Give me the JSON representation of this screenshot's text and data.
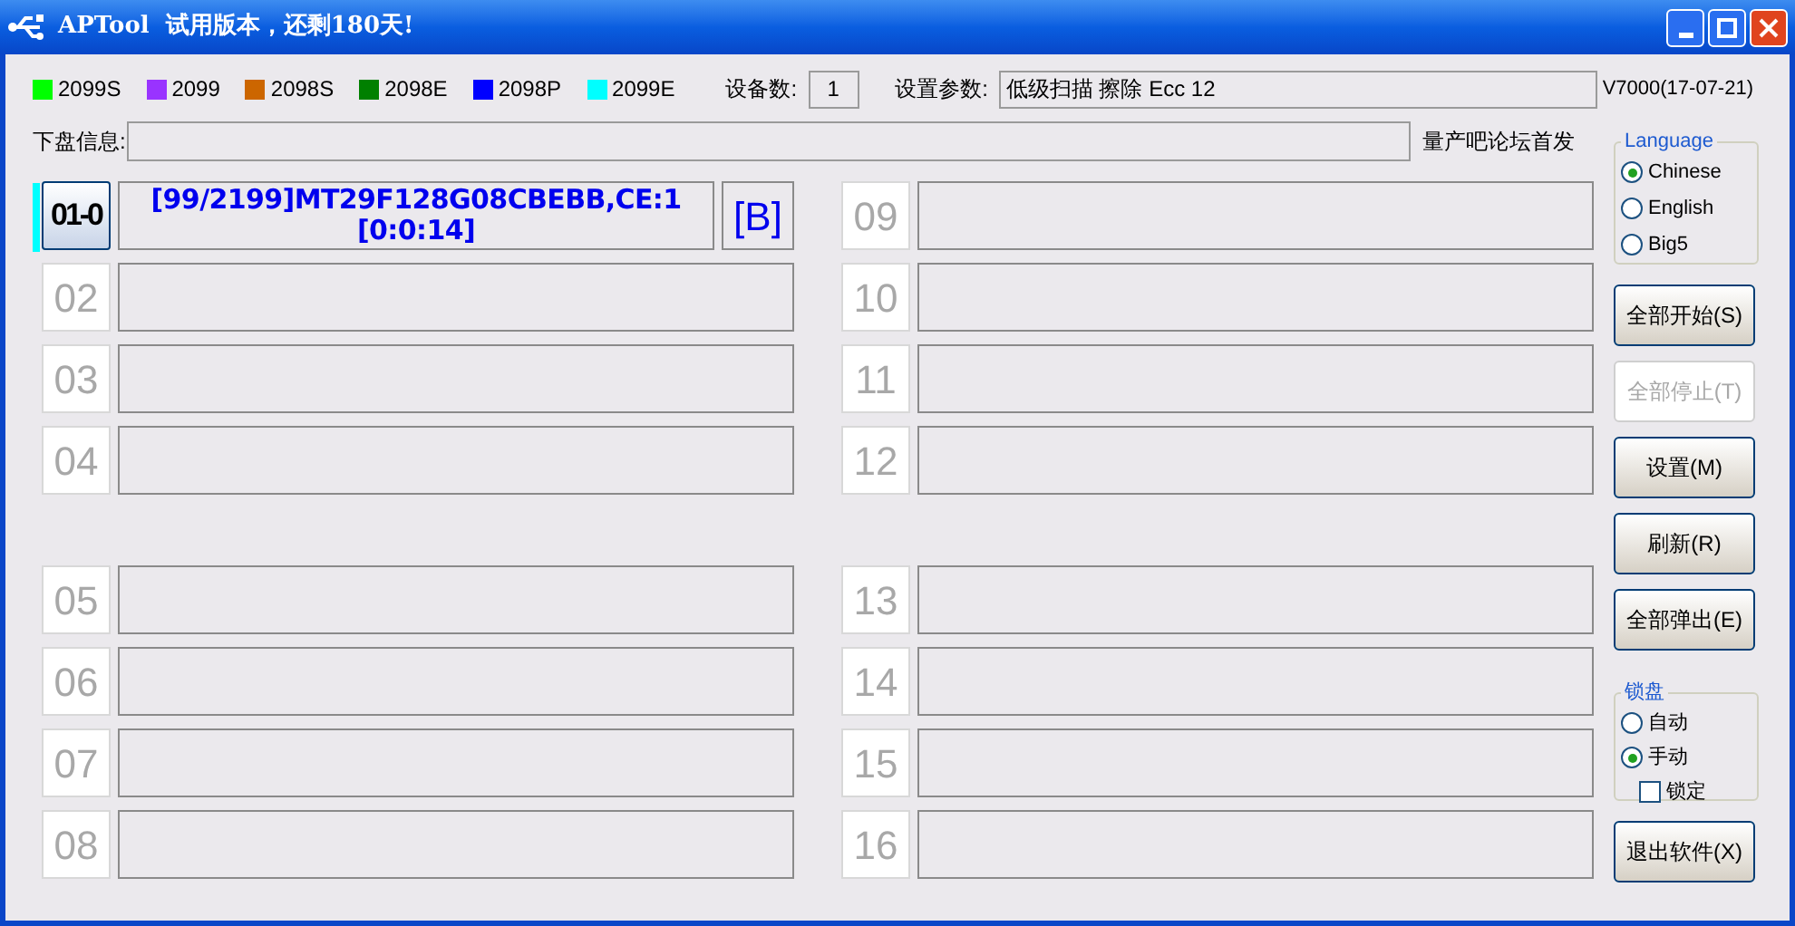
{
  "window": {
    "title": "APTool  试用版本，还剩180天!"
  },
  "legend": [
    {
      "label": "2099S",
      "color": "#00ff00"
    },
    {
      "label": "2099",
      "color": "#9933ff"
    },
    {
      "label": "2098S",
      "color": "#cc6600"
    },
    {
      "label": "2098E",
      "color": "#008000"
    },
    {
      "label": "2098P",
      "color": "#0000ff"
    },
    {
      "label": "2099E",
      "color": "#00ffff"
    }
  ],
  "device_count": {
    "label": "设备数:",
    "value": "1"
  },
  "settings": {
    "label": "设置参数:",
    "value": "低级扫描 擦除 Ecc 12"
  },
  "version": "V7000(17-07-21)",
  "disk_info": {
    "label": "下盘信息:"
  },
  "forum_note": "量产吧论坛首发",
  "slots": [
    {
      "number": "01-0",
      "active": true,
      "lines": [
        "[99/2199]MT29F128G08CBEBB,CE:1",
        "[0:0:14]"
      ],
      "badge": "[B]"
    },
    {
      "number": "02",
      "active": false
    },
    {
      "number": "03",
      "active": false
    },
    {
      "number": "04",
      "active": false
    },
    {
      "number": "05",
      "active": false
    },
    {
      "number": "06",
      "active": false
    },
    {
      "number": "07",
      "active": false
    },
    {
      "number": "08",
      "active": false
    },
    {
      "number": "09",
      "active": false
    },
    {
      "number": "10",
      "active": false
    },
    {
      "number": "11",
      "active": false
    },
    {
      "number": "12",
      "active": false
    },
    {
      "number": "13",
      "active": false
    },
    {
      "number": "14",
      "active": false
    },
    {
      "number": "15",
      "active": false
    },
    {
      "number": "16",
      "active": false
    }
  ],
  "language": {
    "title": "Language",
    "options": [
      {
        "label": "Chinese",
        "selected": true
      },
      {
        "label": "English",
        "selected": false
      },
      {
        "label": "Big5",
        "selected": false
      }
    ]
  },
  "buttons": [
    {
      "label": "全部开始(S)",
      "disabled": false
    },
    {
      "label": "全部停止(T)",
      "disabled": true
    },
    {
      "label": "设置(M)",
      "disabled": false
    },
    {
      "label": "刷新(R)",
      "disabled": false
    },
    {
      "label": "全部弹出(E)",
      "disabled": false
    }
  ],
  "lock": {
    "title": "锁盘",
    "options": [
      {
        "label": "自动",
        "selected": false
      },
      {
        "label": "手动",
        "selected": true
      }
    ],
    "lock_checkbox": {
      "label": "锁定",
      "checked": false
    }
  },
  "exit_button": {
    "label": "退出软件(X)"
  }
}
